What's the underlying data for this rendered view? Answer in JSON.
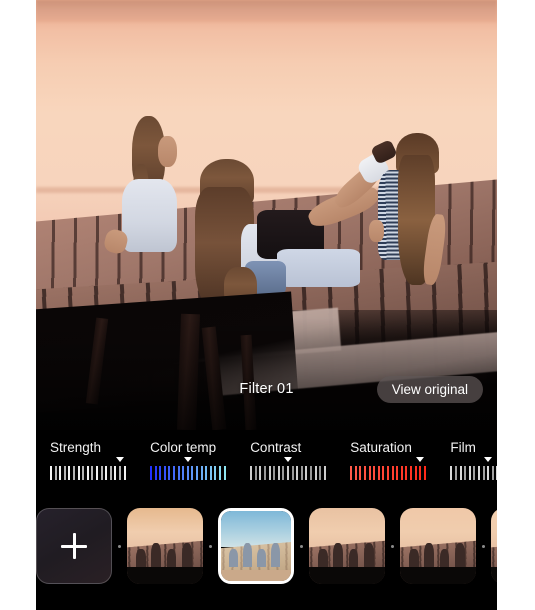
{
  "app": {
    "screen_name": "photo-filter-editor",
    "background_color": "#000000"
  },
  "photo": {
    "alt": "Four friends relaxing on a wooden dock at sunset over calm water",
    "scene": "sunset-dock"
  },
  "overlay": {
    "filter_name": "Filter 01",
    "view_original_label": "View original"
  },
  "adjustments": {
    "controls": [
      {
        "id": "strength",
        "label": "Strength",
        "tick_count": 17,
        "value_index": 15,
        "style": "white",
        "color_start": "#ffffff",
        "color_end": "#ffffff"
      },
      {
        "id": "color-temp",
        "label": "Color temp",
        "tick_count": 17,
        "value_index": 8,
        "style": "gradient",
        "color_start": "#2030ff",
        "color_end": "#8fe6f2"
      },
      {
        "id": "contrast",
        "label": "Contrast",
        "tick_count": 17,
        "value_index": 8,
        "style": "white",
        "color_start": "#d8d8d8",
        "color_end": "#ffffff"
      },
      {
        "id": "saturation",
        "label": "Saturation",
        "tick_count": 17,
        "value_index": 15,
        "style": "gradient",
        "color_start": "#ff5a4a",
        "color_end": "#ff2a1a"
      },
      {
        "id": "film",
        "label": "Film",
        "tick_count": 17,
        "value_index": 8,
        "style": "white",
        "color_start": "#e6e6e6",
        "color_end": "#ffffff"
      }
    ]
  },
  "filter_strip": {
    "add_button_label": "+",
    "selected_index": 2,
    "items": [
      {
        "id": "add",
        "type": "add",
        "label": "+"
      },
      {
        "id": "filter-00",
        "type": "filter",
        "label": "",
        "sky": "#e6b98e",
        "tone": "warm"
      },
      {
        "id": "filter-01",
        "type": "filter",
        "label": "",
        "sky": "#7fb8d8",
        "tone": "cool",
        "selected": true
      },
      {
        "id": "filter-02",
        "type": "filter",
        "label": "",
        "sky": "#e9c2a2",
        "tone": "warm"
      },
      {
        "id": "filter-03",
        "type": "filter",
        "label": "",
        "sky": "#f0c8a8",
        "tone": "warm"
      },
      {
        "id": "filter-04",
        "type": "filter",
        "label": "",
        "sky": "#f3d0b0",
        "tone": "warm"
      }
    ]
  }
}
